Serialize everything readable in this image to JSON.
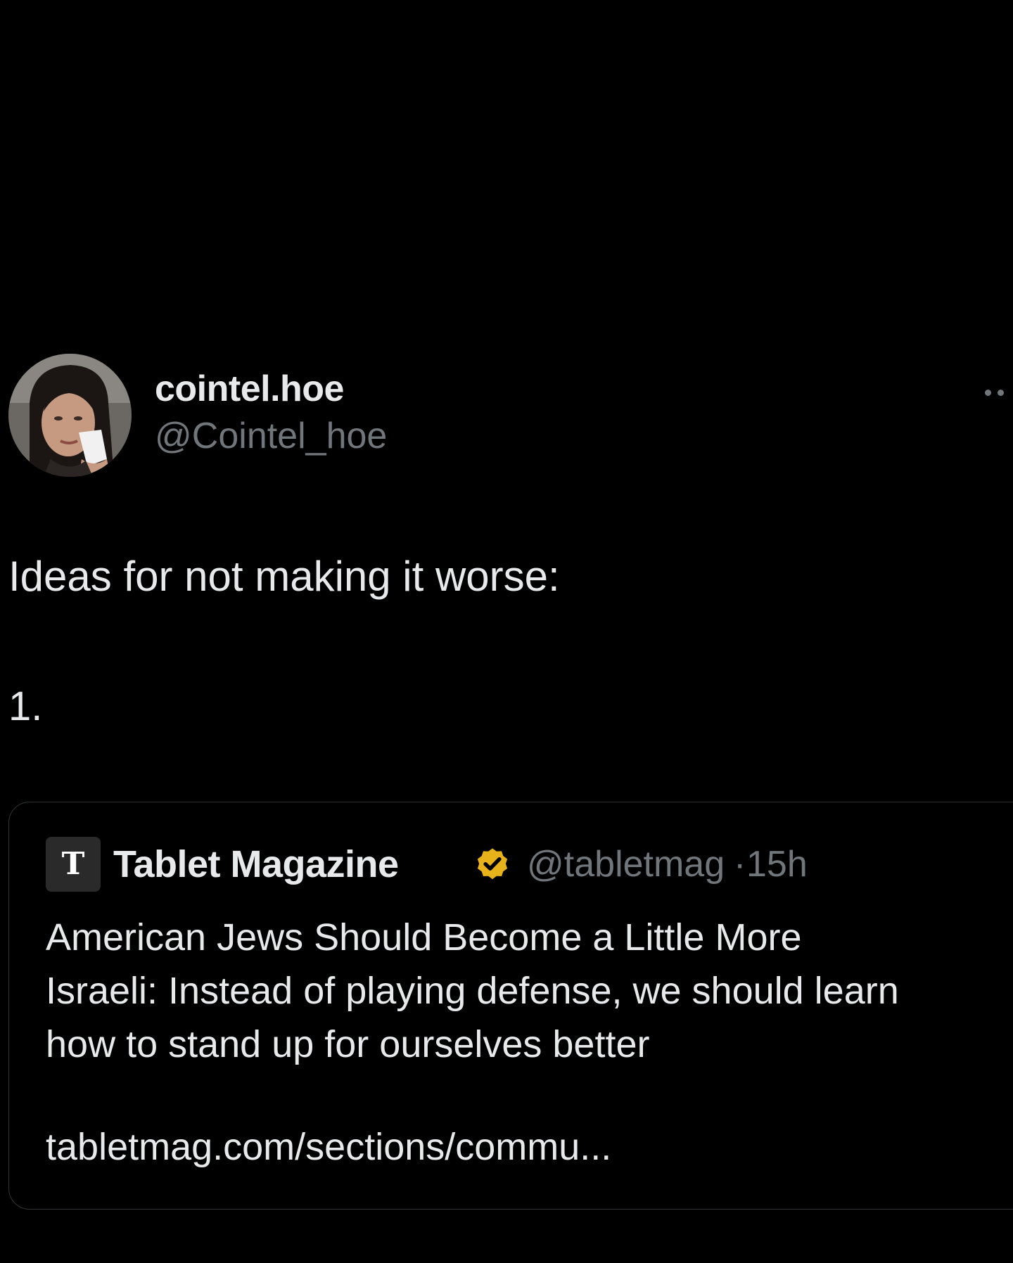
{
  "post": {
    "author": {
      "display_name": "cointel.hoe",
      "handle": "@Cointel_hoe",
      "avatar_icon": "profile-photo"
    },
    "more_icon": "ellipsis-icon",
    "text_line_1": "Ideas for not making it worse:",
    "text_line_2": "1.",
    "quoted": {
      "logo_letter": "T",
      "display_name": "Tablet Magazine",
      "verified_icon": "verified-badge-icon",
      "verified_color": "#e8b21b",
      "handle": "@tabletmag",
      "separator": "·",
      "time": "15h",
      "lines": [
        "American Jews Should Become a Little More",
        "Israeli: Instead of playing defense, we should learn",
        "how to stand up for ourselves better"
      ],
      "link": "tabletmag.com/sections/commu..."
    }
  },
  "colors": {
    "background": "#000000",
    "primary_text": "#e7e9ea",
    "secondary_text": "#71767b",
    "border": "#2f3336"
  }
}
